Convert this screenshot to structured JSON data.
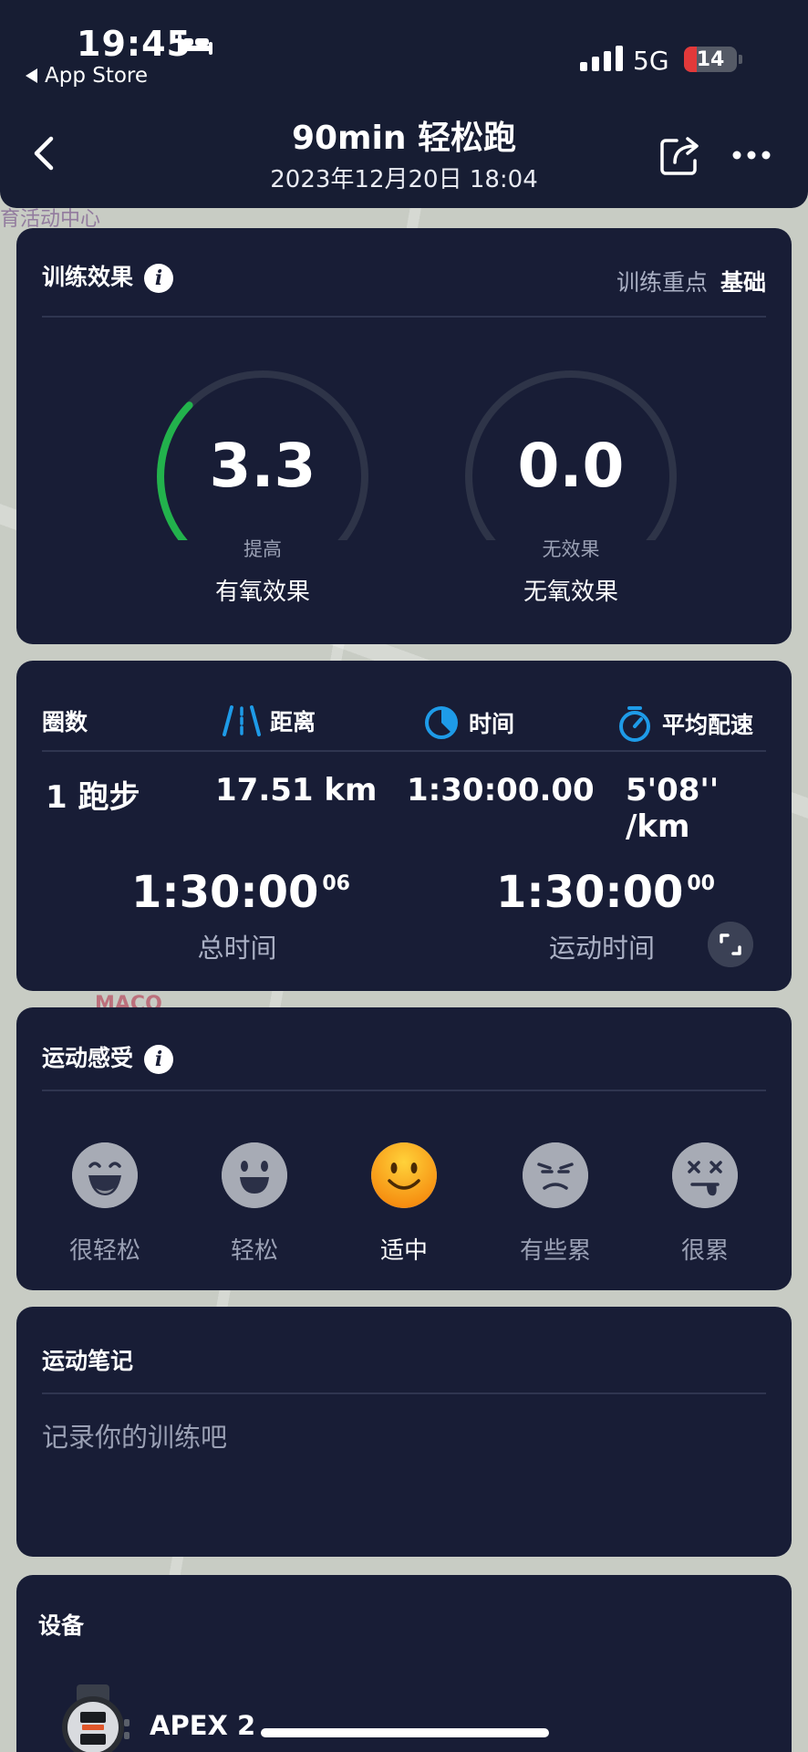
{
  "status_bar": {
    "time": "19:45",
    "back_app": "App Store",
    "network": "5G",
    "battery": "14"
  },
  "nav": {
    "title": "90min 轻松跑",
    "subtitle": "2023年12月20日 18:04"
  },
  "map_labels": [
    "育活动中心",
    "MACO"
  ],
  "training_effect": {
    "title": "训练效果",
    "focus_label": "训练重点",
    "focus_value": "基础",
    "aerobic": {
      "value": "3.3",
      "level": "提高",
      "label": "有氧效果",
      "fraction": 0.33
    },
    "anaerobic": {
      "value": "0.0",
      "level": "无效果",
      "label": "无氧效果",
      "fraction": 0.0
    },
    "colors": {
      "aerobic_arc": "#22b24c",
      "track": "#2e3448"
    }
  },
  "laps": {
    "headers": {
      "laps": "圈数",
      "distance": "距离",
      "time": "时间",
      "pace": "平均配速"
    },
    "row": {
      "laps": "1 跑步",
      "distance": "17.51 km",
      "time": "1:30:00.00",
      "pace": "5'08'' /km"
    },
    "total_time": {
      "main": "1:30:00",
      "sup": "06",
      "label": "总时间"
    },
    "moving_time": {
      "main": "1:30:00",
      "sup": "00",
      "label": "运动时间"
    },
    "icon_color": "#1e9be8"
  },
  "feeling": {
    "title": "运动感受",
    "options": [
      "很轻松",
      "轻松",
      "适中",
      "有些累",
      "很累"
    ],
    "selected": "适中"
  },
  "notes": {
    "title": "运动笔记",
    "placeholder": "记录你的训练吧"
  },
  "device": {
    "title": "设备",
    "name": "APEX 2"
  }
}
